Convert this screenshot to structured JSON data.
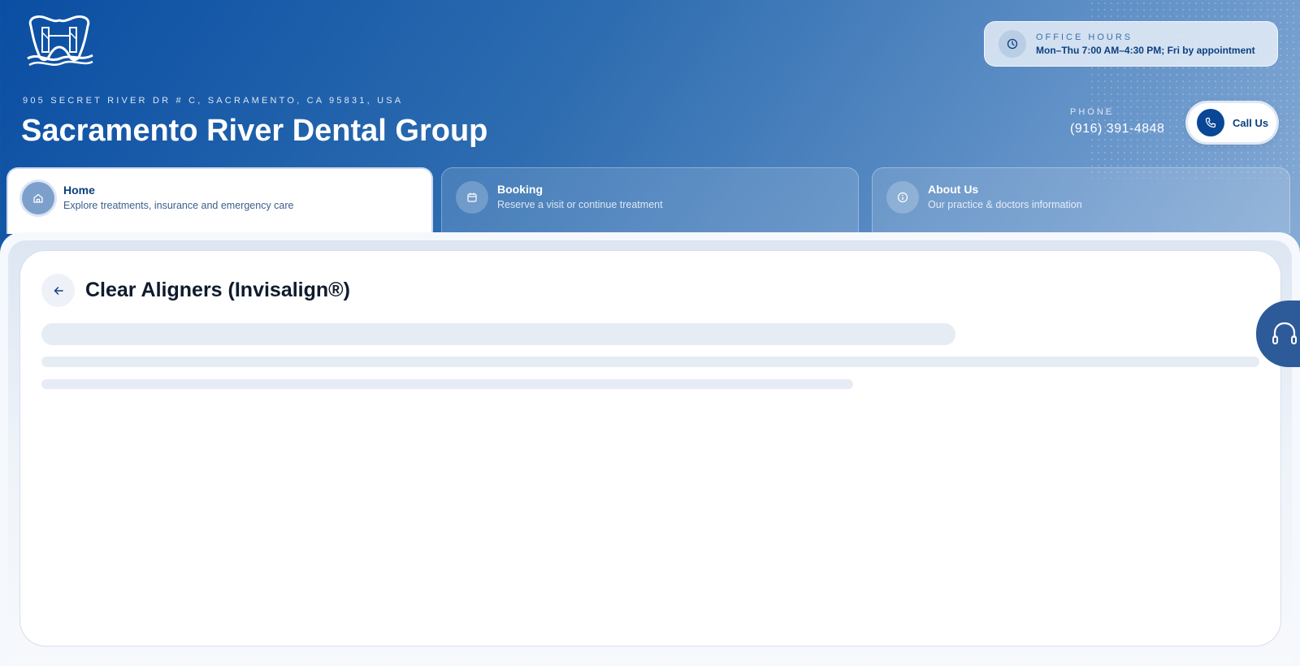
{
  "header": {
    "address": "905 SECRET RIVER DR # C, SACRAMENTO, CA 95831, USA",
    "practice_name": "Sacramento River Dental Group",
    "office_hours": {
      "label": "OFFICE HOURS",
      "value": "Mon–Thu 7:00 AM–4:30 PM; Fri by appointment",
      "icon": "clock-icon"
    },
    "phone": {
      "label": "PHONE",
      "number": "(916) 391-4848"
    },
    "call_button": {
      "label": "Call Us",
      "icon": "phone-icon"
    }
  },
  "tabs": [
    {
      "title": "Home",
      "subtitle": "Explore treatments, insurance and emergency care",
      "icon": "home-icon",
      "active": true
    },
    {
      "title": "Booking",
      "subtitle": "Reserve a visit or continue treatment",
      "icon": "calendar-icon",
      "active": false
    },
    {
      "title": "About Us",
      "subtitle": "Our practice & doctors information",
      "icon": "info-icon",
      "active": false
    }
  ],
  "main": {
    "title": "Clear Aligners (Invisalign®)",
    "back_icon": "arrow-left-icon",
    "loading": true
  },
  "support_icon": "headset-icon",
  "colors": {
    "brand_dark": "#0a4696",
    "brand_text": "#0c3f80",
    "skeleton": "#e6ecf4"
  }
}
